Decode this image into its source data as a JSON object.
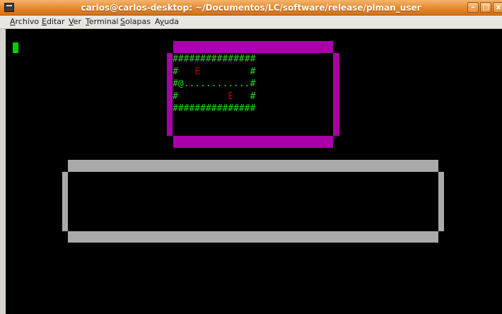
{
  "window": {
    "title": "carlos@carlos-desktop: ~/Documentos/LC/software/release/plman_user",
    "buttons": {
      "minimize": "–",
      "maximize": "□",
      "close": "x"
    }
  },
  "menu": {
    "items": [
      {
        "accel": "A",
        "rest": "rchivo"
      },
      {
        "accel": "E",
        "rest": "ditar"
      },
      {
        "accel": "V",
        "rest": "er"
      },
      {
        "accel": "T",
        "rest": "erminal"
      },
      {
        "accel": "S",
        "rest": "olapas"
      },
      {
        "prefix": "A",
        "accel": "y",
        "rest": "uda"
      }
    ]
  },
  "map": {
    "row1": "###############",
    "row2_a": "#   ",
    "row2_enemy": "E",
    "row2_b": "         #",
    "row3": "#@............#",
    "row4_a": "#         ",
    "row4_enemy": "E",
    "row4_b": "   #",
    "row5": "###############"
  },
  "colors": {
    "titlebar": "#e48a2e",
    "terminal_bg": "#000000",
    "cursor": "#00d000",
    "map_text": "#1cd81c",
    "enemy": "#b00000",
    "map_frame": "#aa00aa",
    "message_frame": "#aaaaaa"
  }
}
